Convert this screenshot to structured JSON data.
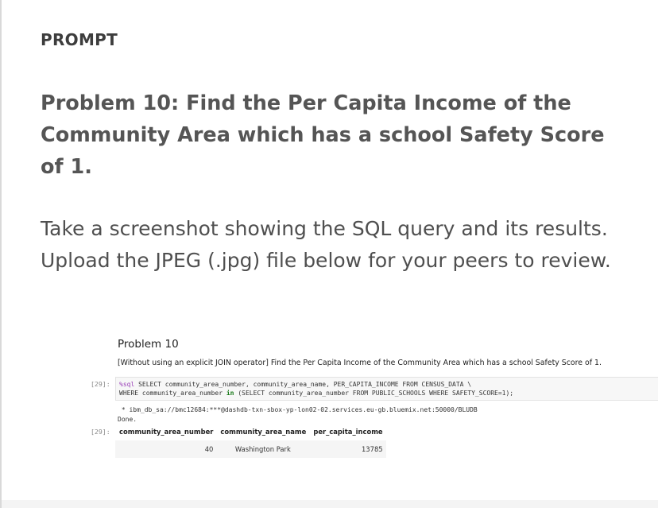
{
  "prompt_label": "PROMPT",
  "problem_title": "Problem 10: Find the Per Capita Income of the Community Area which has a school Safety Score of 1.",
  "instructions": "Take a screenshot showing the SQL query and its results. Upload the JPEG (.jpg) file below for your peers to review.",
  "notebook": {
    "heading": "Problem 10",
    "description": "[Without using an explicit JOIN operator] Find the Per Capita Income of the Community Area which has a school Safety Score of 1.",
    "input_prompt": "[29]:",
    "output_prompt": "[29]:",
    "code": {
      "magic": "%sql",
      "line1_rest": " SELECT community_area_number, community_area_name, PER_CAPITA_INCOME FROM CENSUS_DATA \\",
      "line2_a": "WHERE community_area_number ",
      "line2_in": "in",
      "line2_b": " (SELECT community_area_number FROM PUBLIC_SCHOOLS WHERE SAFETY_SCORE=1);"
    },
    "connection": " * ibm_db_sa://bmc12684:***@dashdb-txn-sbox-yp-lon02-02.services.eu-gb.bluemix.net:50000/BLUDB",
    "status": "Done.",
    "table": {
      "headers": [
        "community_area_number",
        "community_area_name",
        "per_capita_income"
      ],
      "rows": [
        [
          "40",
          "Washington Park",
          "13785"
        ]
      ]
    }
  }
}
